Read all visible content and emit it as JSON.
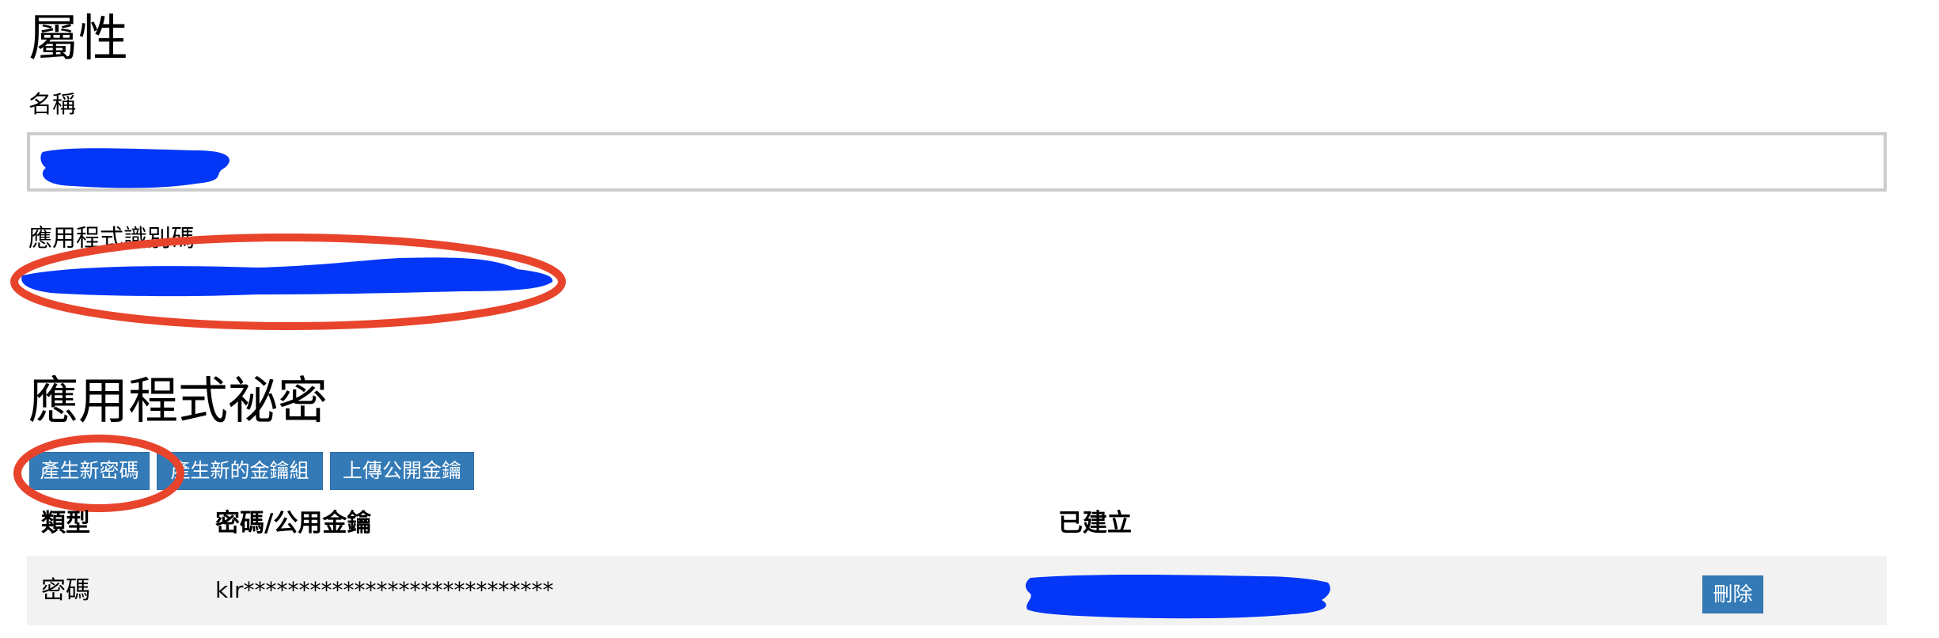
{
  "properties": {
    "heading": "屬性",
    "name_label": "名稱",
    "name_value": "",
    "app_id_label": "應用程式識別碼"
  },
  "secrets": {
    "heading": "應用程式祕密",
    "buttons": {
      "new_password": "產生新密碼",
      "new_key_pair": "產生新的金鑰組",
      "upload_public_key": "上傳公開金鑰"
    },
    "table": {
      "columns": [
        "類型",
        "密碼/公用金鑰",
        "已建立"
      ],
      "rows": [
        {
          "type": "密碼",
          "secret": "klr****************************",
          "created": "",
          "action": "刪除"
        }
      ]
    }
  },
  "colors": {
    "button": "#337ab7",
    "redaction": "#0336f6",
    "annotation": "#e8442c",
    "row_background": "#f2f2f2",
    "input_border": "#cccccc"
  }
}
